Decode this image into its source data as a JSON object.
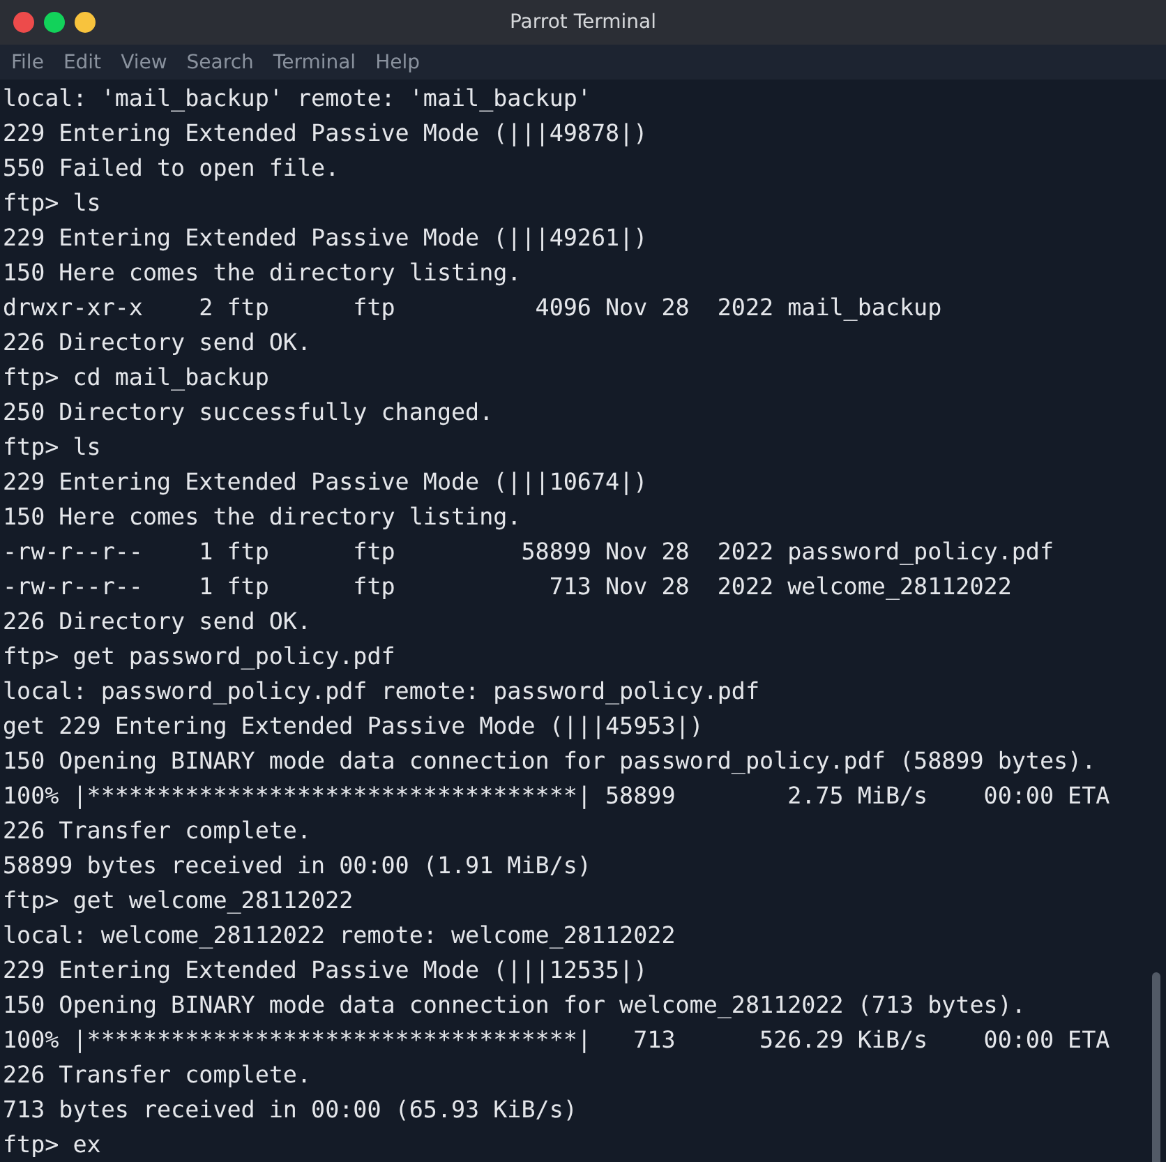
{
  "window": {
    "title": "Parrot Terminal"
  },
  "menu": [
    "File",
    "Edit",
    "View",
    "Search",
    "Terminal",
    "Help"
  ],
  "terminal": {
    "lines": [
      "local: 'mail_backup' remote: 'mail_backup'",
      "229 Entering Extended Passive Mode (|||49878|)",
      "550 Failed to open file.",
      "ftp> ls",
      "229 Entering Extended Passive Mode (|||49261|)",
      "150 Here comes the directory listing.",
      "drwxr-xr-x    2 ftp      ftp          4096 Nov 28  2022 mail_backup",
      "226 Directory send OK.",
      "ftp> cd mail_backup",
      "250 Directory successfully changed.",
      "ftp> ls",
      "229 Entering Extended Passive Mode (|||10674|)",
      "150 Here comes the directory listing.",
      "-rw-r--r--    1 ftp      ftp         58899 Nov 28  2022 password_policy.pdf",
      "-rw-r--r--    1 ftp      ftp           713 Nov 28  2022 welcome_28112022",
      "226 Directory send OK.",
      "ftp> get password_policy.pdf",
      "local: password_policy.pdf remote: password_policy.pdf",
      "get 229 Entering Extended Passive Mode (|||45953|)",
      "150 Opening BINARY mode data connection for password_policy.pdf (58899 bytes).",
      "100% |***********************************| 58899        2.75 MiB/s    00:00 ETA",
      "226 Transfer complete.",
      "58899 bytes received in 00:00 (1.91 MiB/s)",
      "ftp> get welcome_28112022",
      "local: welcome_28112022 remote: welcome_28112022",
      "229 Entering Extended Passive Mode (|||12535|)",
      "150 Opening BINARY mode data connection for welcome_28112022 (713 bytes).",
      "100% |***********************************|   713      526.29 KiB/s    00:00 ETA",
      "226 Transfer complete.",
      "713 bytes received in 00:00 (65.93 KiB/s)",
      "ftp> ex"
    ]
  }
}
